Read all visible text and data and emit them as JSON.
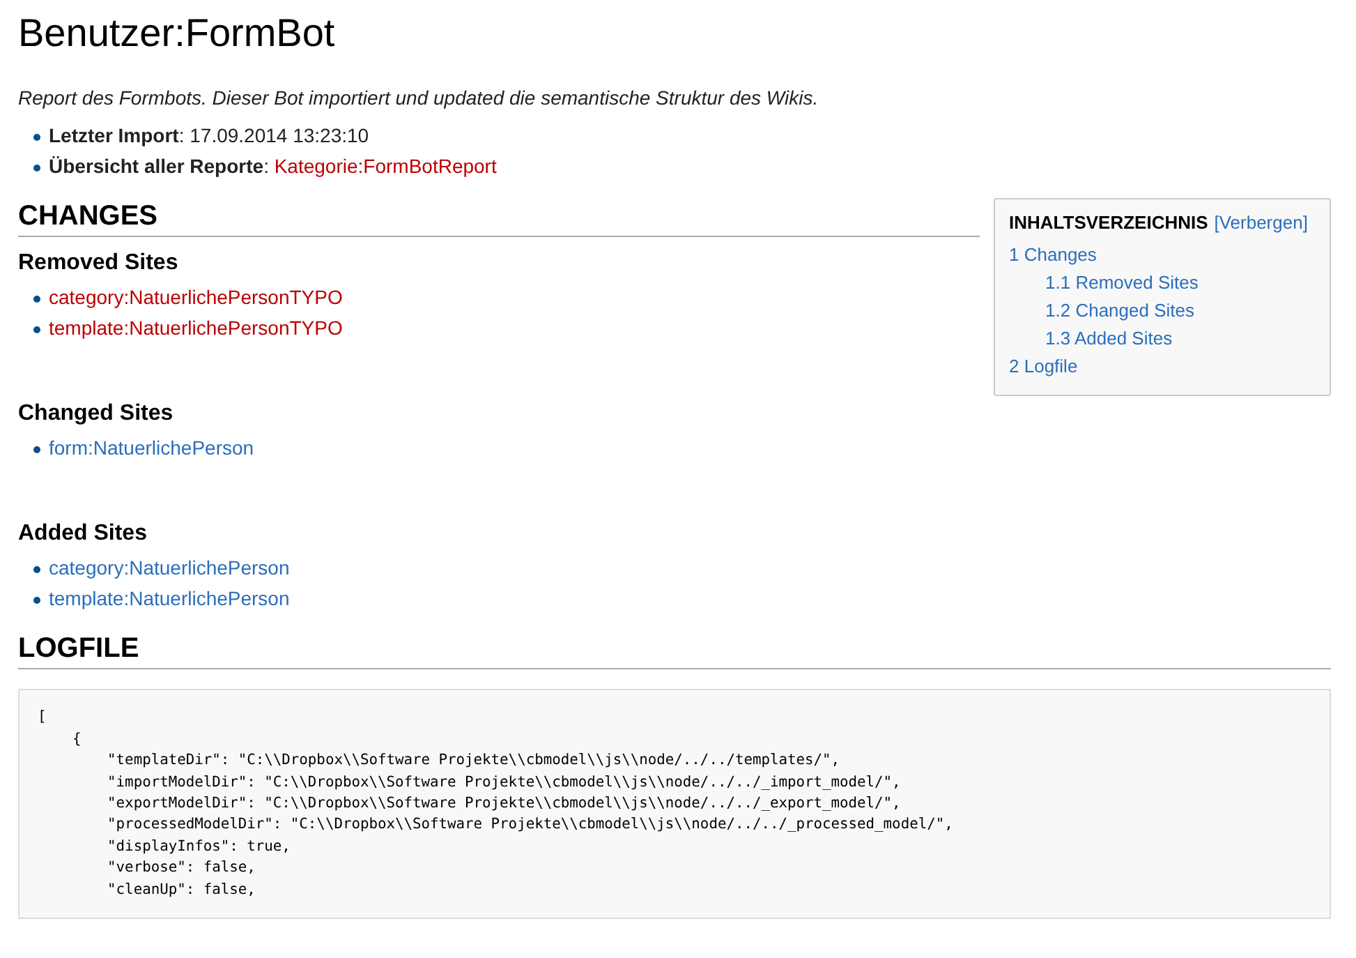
{
  "title": "Benutzer:FormBot",
  "intro": "Report des Formbots. Dieser Bot importiert und updated die semantische Struktur des Wikis.",
  "facts": [
    {
      "label": "**Letzter Import**:",
      "value": "17.09.2014 13:23:10",
      "kind": "text"
    },
    {
      "label": "**Übersicht aller Reporte**:",
      "value": "Kategorie:FormBotReport",
      "kind": "missing"
    }
  ],
  "toc": {
    "title": "INHALTSVERZEICHNIS",
    "toggle": "[Verbergen]",
    "items": [
      {
        "number": "1",
        "label": "Changes",
        "children": [
          {
            "number": "1.1",
            "label": "Removed Sites"
          },
          {
            "number": "1.2",
            "label": "Changed Sites"
          },
          {
            "number": "1.3",
            "label": "Added Sites"
          }
        ]
      },
      {
        "number": "2",
        "label": "Logfile"
      }
    ]
  },
  "sections": [
    {
      "heading": "CHANGES",
      "subsections": [
        {
          "heading": "Removed Sites",
          "links": [
            {
              "text": "category:NatuerlichePersonTYPO",
              "kind": "missing"
            },
            {
              "text": "template:NatuerlichePersonTYPO",
              "kind": "missing"
            }
          ]
        },
        {
          "heading": "Changed Sites",
          "links": [
            {
              "text": "form:NatuerlichePerson",
              "kind": "existing"
            }
          ]
        },
        {
          "heading": "Added Sites",
          "links": [
            {
              "text": "category:NatuerlichePerson",
              "kind": "existing"
            },
            {
              "text": "template:NatuerlichePerson",
              "kind": "existing"
            }
          ]
        }
      ]
    },
    {
      "heading": "LOGFILE"
    }
  ],
  "logfile": "[\n    {\n        \"templateDir\": \"C:\\\\Dropbox\\\\Software Projekte\\\\cbmodel\\\\js\\\\node/../../templates/\",\n        \"importModelDir\": \"C:\\\\Dropbox\\\\Software Projekte\\\\cbmodel\\\\js\\\\node/../../_import_model/\",\n        \"exportModelDir\": \"C:\\\\Dropbox\\\\Software Projekte\\\\cbmodel\\\\js\\\\node/../../_export_model/\",\n        \"processedModelDir\": \"C:\\\\Dropbox\\\\Software Projekte\\\\cbmodel\\\\js\\\\node/../../_processed_model/\",\n        \"displayInfos\": true,\n        \"verbose\": false,\n        \"cleanUp\": false,"
}
